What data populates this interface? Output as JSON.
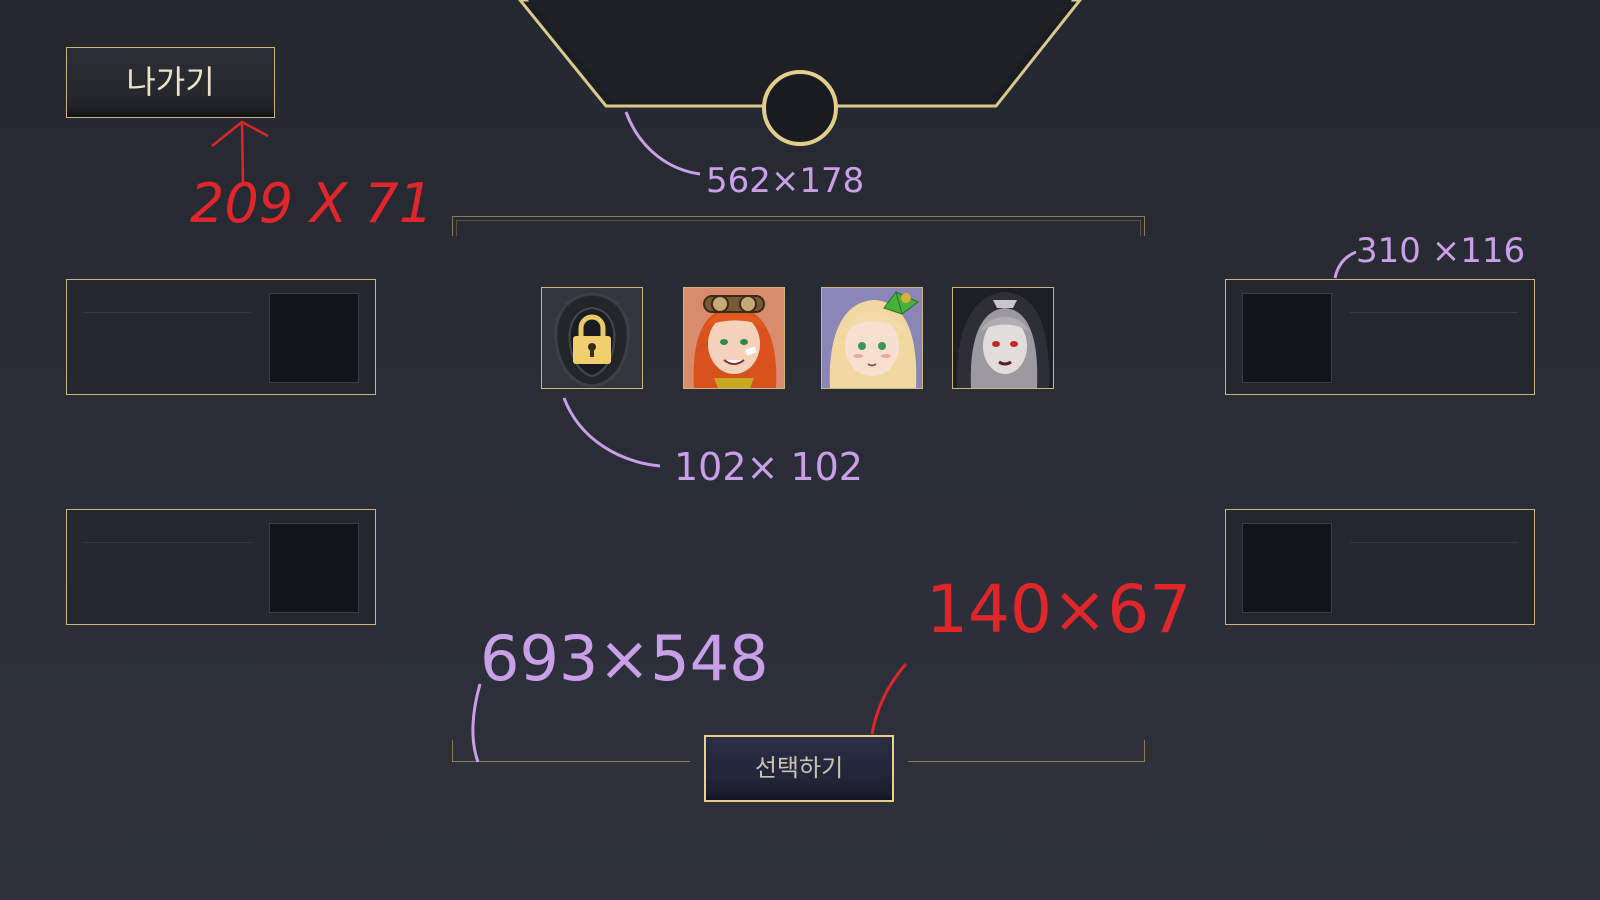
{
  "header": {
    "exit_label": "나가기",
    "select_label": "선택하기"
  },
  "characters": [
    {
      "name": "locked",
      "locked": true
    },
    {
      "name": "orange-haired-goggles-girl",
      "locked": false
    },
    {
      "name": "blonde-green-bow-girl",
      "locked": false
    },
    {
      "name": "hooded-dark-girl",
      "locked": false
    }
  ],
  "annotations": {
    "exit_size": "209 X 71",
    "header_size": "562×178",
    "panel_size": "310 ×116",
    "slot_size": "102× 102",
    "frame_size": "693×548",
    "select_size": "140×67"
  },
  "colors": {
    "gold_border": "#c8b67e",
    "bg": "#2a2c35",
    "annotation_red": "#e0262a",
    "annotation_purple": "#c9a0e8"
  }
}
